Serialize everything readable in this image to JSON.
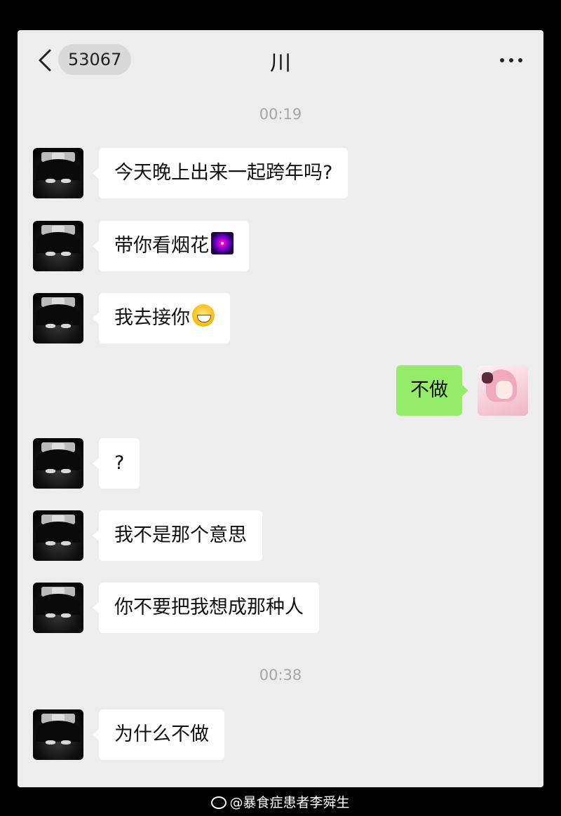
{
  "header": {
    "unread_count": "53067",
    "title": "川",
    "more_icon": "more-horizontal-icon",
    "back_icon": "chevron-left-icon"
  },
  "timestamps": [
    "00:19",
    "00:38"
  ],
  "messages": [
    {
      "sender": "other",
      "text": "今天晚上出来一起跨年吗?"
    },
    {
      "sender": "other",
      "text": "带你看烟花",
      "emoji": "fireworks-emoji"
    },
    {
      "sender": "other",
      "text": "我去接你",
      "emoji": "grinning-face-emoji"
    },
    {
      "sender": "me",
      "text": "不做"
    },
    {
      "sender": "other",
      "text": "?"
    },
    {
      "sender": "other",
      "text": "我不是那个意思"
    },
    {
      "sender": "other",
      "text": "你不要把我想成那种人"
    },
    {
      "sender": "other",
      "text": "为什么不做"
    }
  ],
  "colors": {
    "background": "#ededed",
    "bubble_other": "#ffffff",
    "bubble_me": "#95ec69",
    "timestamp": "#a6a6a6"
  },
  "watermark": {
    "icon": "weibo-icon",
    "text": "@暴食症患者李舜生"
  }
}
